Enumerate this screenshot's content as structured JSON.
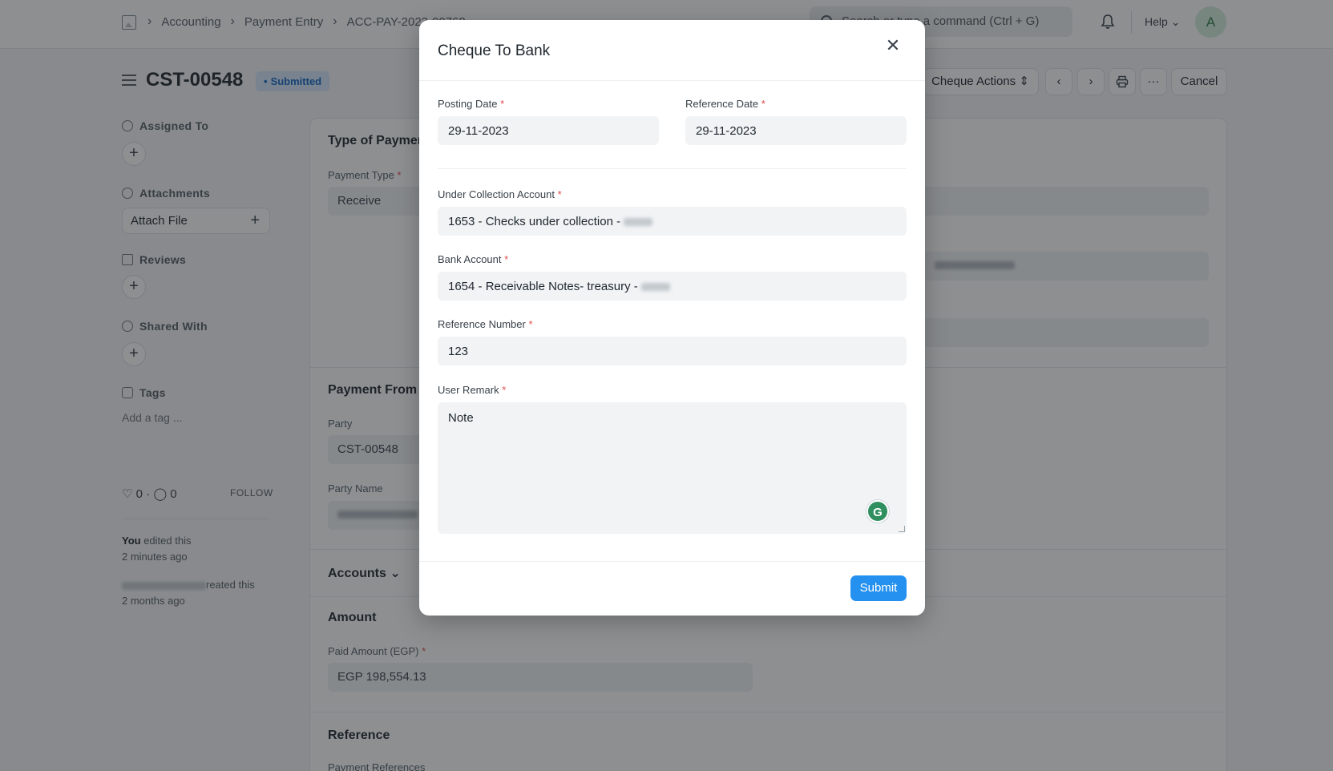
{
  "navbar": {
    "breadcrumbs": [
      "Accounting",
      "Payment Entry",
      "ACC-PAY-2023-00768"
    ],
    "search_placeholder": "Search or type a command (Ctrl + G)",
    "help_label": "Help",
    "avatar_initial": "A"
  },
  "page": {
    "title": "CST-00548",
    "status": "Submitted",
    "actions": {
      "cheque_actions": "Cheque Actions",
      "more": "···",
      "cancel": "Cancel"
    }
  },
  "sidebar": {
    "assigned_to": "Assigned To",
    "attachments": "Attachments",
    "attach_file": "Attach File",
    "reviews": "Reviews",
    "shared_with": "Shared With",
    "tags": "Tags",
    "add_tag": "Add a tag ...",
    "likes_count": "0",
    "comments_count": "0",
    "follow": "FOLLOW",
    "activity": [
      {
        "actor": "You",
        "action": " edited this",
        "time": "2 minutes ago"
      },
      {
        "action": "reated this",
        "time": "2 months ago"
      }
    ]
  },
  "form": {
    "type_of_payment": "Type of Payment",
    "payment_type_label": "Payment Type",
    "payment_type_value": "Receive",
    "payment_from_to": "Payment From / To",
    "party_label": "Party",
    "party_value": "CST-00548",
    "party_name_label": "Party Name",
    "accounts": "Accounts",
    "amount": "Amount",
    "paid_amount_label": "Paid Amount (EGP)",
    "paid_amount_value": "EGP 198,554.13",
    "reference": "Reference",
    "payment_references_label": "Payment References"
  },
  "modal": {
    "title": "Cheque To Bank",
    "posting_date_label": "Posting Date",
    "posting_date_value": "29-11-2023",
    "reference_date_label": "Reference Date",
    "reference_date_value": "29-11-2023",
    "under_collection_label": "Under Collection Account",
    "under_collection_value": "1653 - Checks under collection -",
    "bank_account_label": "Bank Account",
    "bank_account_value": "1654 - Receivable Notes- treasury -",
    "reference_number_label": "Reference Number",
    "reference_number_value": "123",
    "user_remark_label": "User Remark",
    "user_remark_value": "Note",
    "submit": "Submit",
    "required_mark": "*"
  },
  "colors": {
    "primary": "#2490ef",
    "status_badge_bg": "#d4e7fb",
    "status_badge_text": "#1366c2",
    "required": "#e24c4c",
    "overlay": "rgba(28,32,36,0.5)"
  }
}
